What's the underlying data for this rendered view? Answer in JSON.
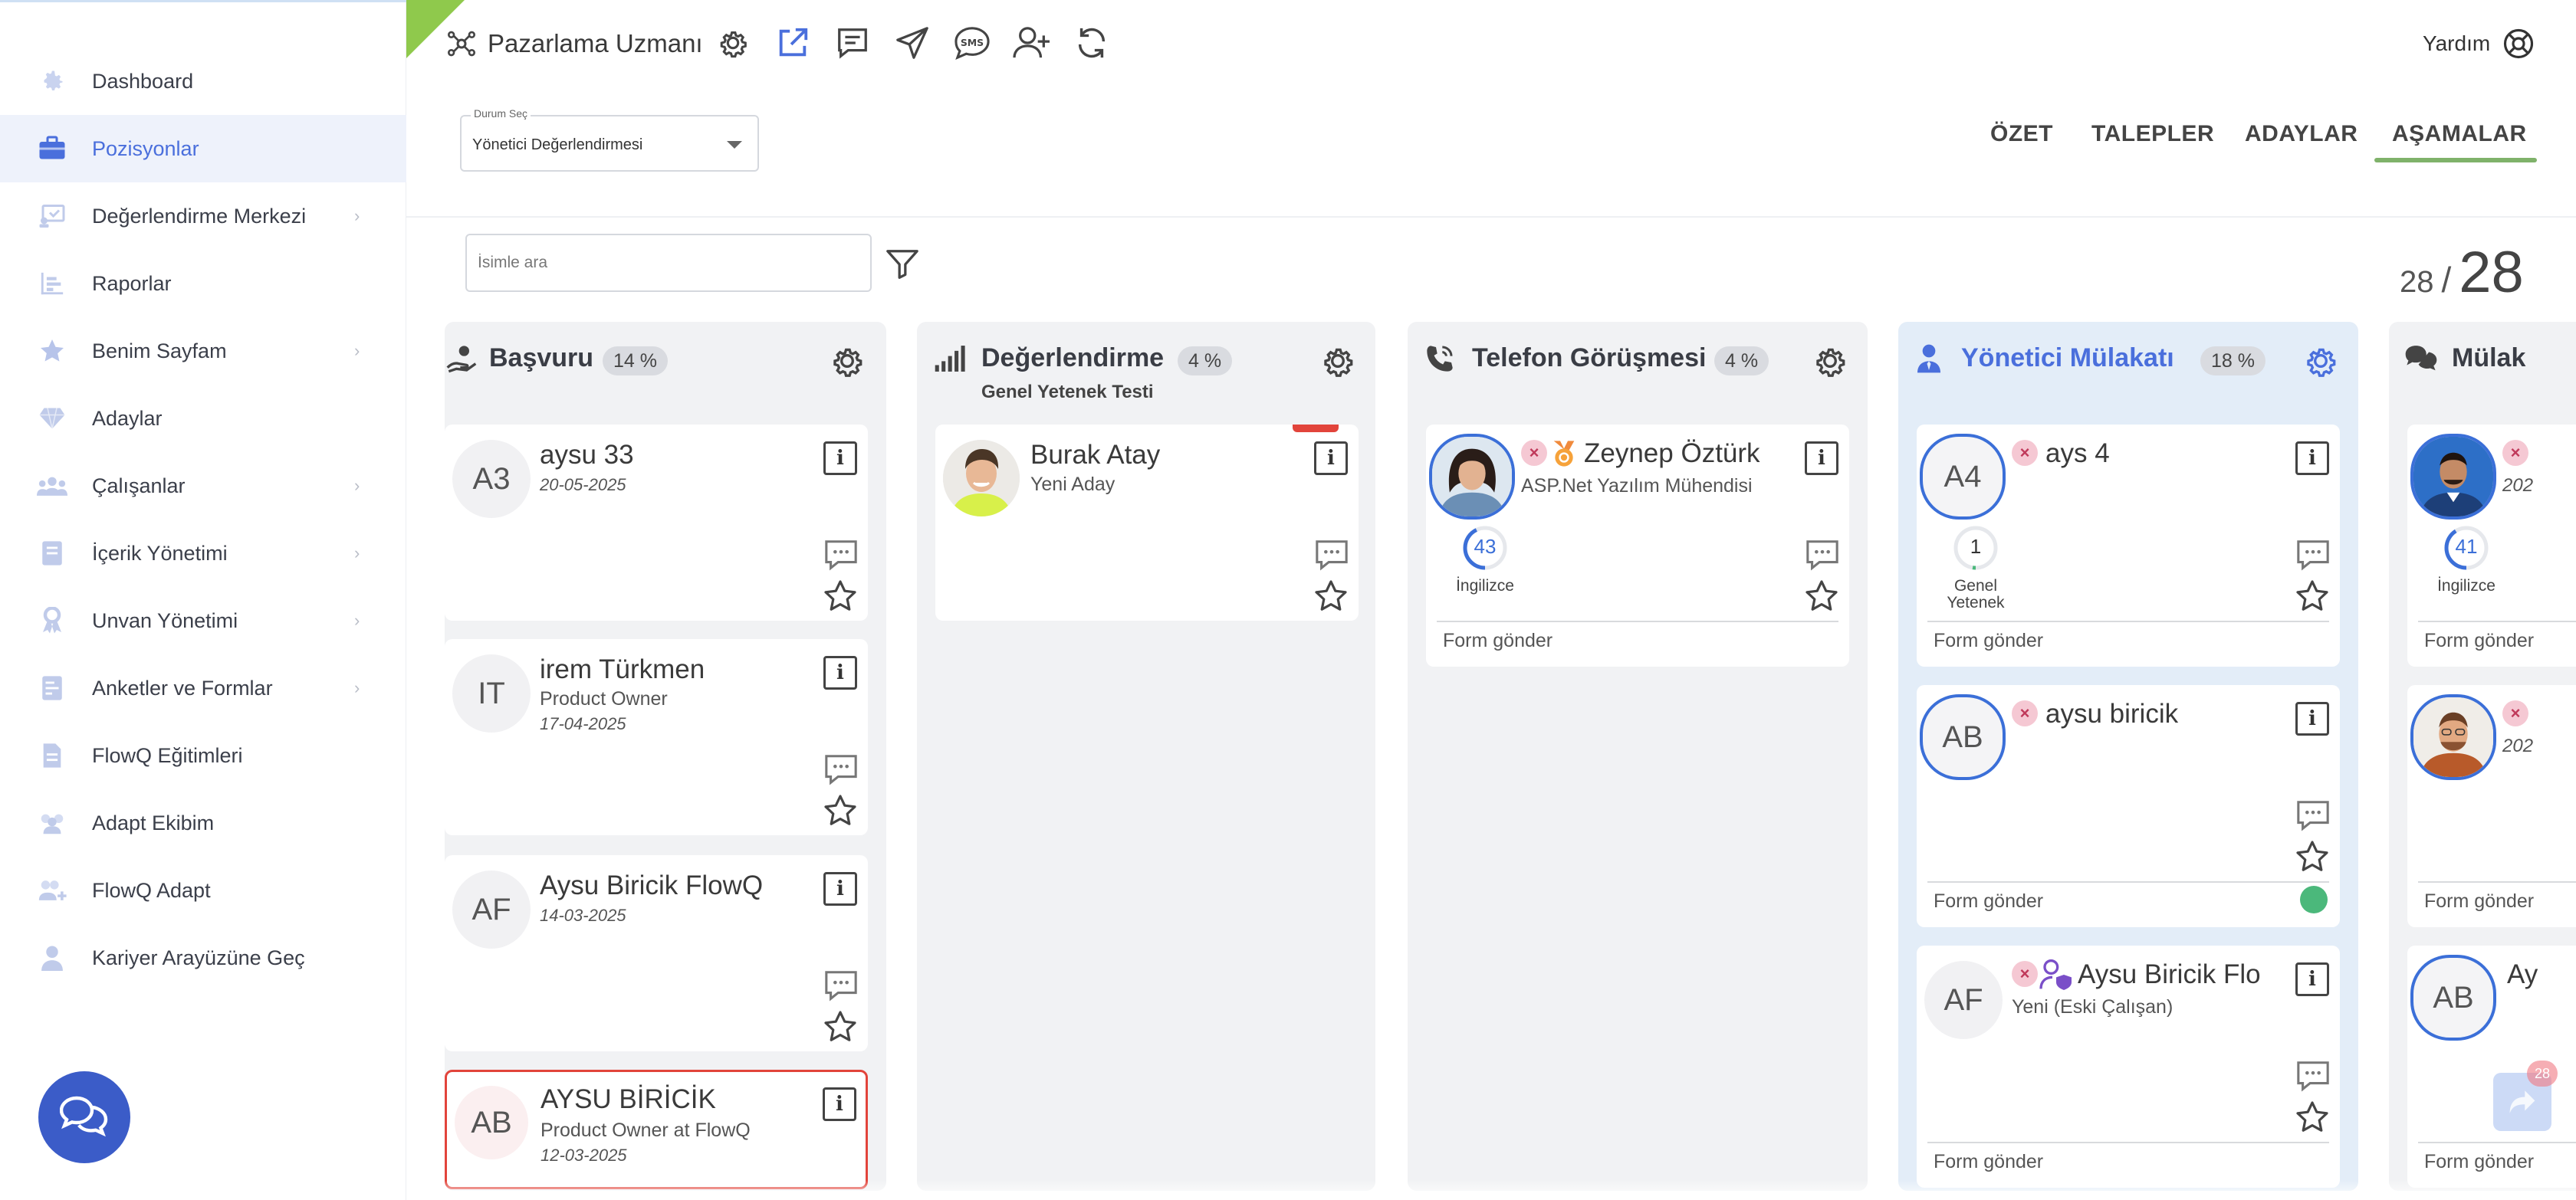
{
  "sidebar": {
    "items": [
      {
        "label": "Dashboard",
        "icon": "gear-icon"
      },
      {
        "label": "Pozisyonlar",
        "icon": "briefcase-icon"
      },
      {
        "label": "Değerlendirme Merkezi",
        "icon": "assessment-icon"
      },
      {
        "label": "Raporlar",
        "icon": "report-icon"
      },
      {
        "label": "Benim Sayfam",
        "icon": "star-icon"
      },
      {
        "label": "Adaylar",
        "icon": "diamond-icon"
      },
      {
        "label": "Çalışanlar",
        "icon": "people-icon"
      },
      {
        "label": "İçerik Yönetimi",
        "icon": "book-icon"
      },
      {
        "label": "Unvan Yönetimi",
        "icon": "ribbon-icon"
      },
      {
        "label": "Anketler ve Formlar",
        "icon": "form-icon"
      },
      {
        "label": "FlowQ Eğitimleri",
        "icon": "document-icon"
      },
      {
        "label": "Adapt Ekibim",
        "icon": "team-icon"
      },
      {
        "label": "FlowQ Adapt",
        "icon": "add-team-icon"
      },
      {
        "label": "Kariyer Arayüzüne Geç",
        "icon": "user-icon"
      }
    ]
  },
  "header": {
    "title": "Pazarlama Uzmanı",
    "help_label": "Yardım",
    "status_select": {
      "label": "Durum Seç",
      "value": "Yönetici Değerlendirmesi"
    },
    "tabs": [
      "ÖZET",
      "TALEPLER",
      "ADAYLAR",
      "AŞAMALAR"
    ],
    "search_placeholder": "İsimle ara",
    "count_shown": "28",
    "count_sep": "/",
    "count_total": "28"
  },
  "columns": [
    {
      "title": "Başvuru",
      "pct": "14 %",
      "cards": [
        {
          "initials": "A3",
          "name": "aysu 33",
          "date": "20-05-2025"
        },
        {
          "initials": "IT",
          "name": "irem Türkmen",
          "sub": "Product Owner",
          "date": "17-04-2025"
        },
        {
          "initials": "AF",
          "name": "Aysu Biricik FlowQ",
          "date": "14-03-2025"
        },
        {
          "initials": "AB",
          "name": "AYSU BİRİCİK",
          "sub": "Product Owner at FlowQ",
          "date": "12-03-2025"
        }
      ]
    },
    {
      "title": "Değerlendirme",
      "pct": "4 %",
      "subtitle": "Genel Yetenek Testi",
      "cards": [
        {
          "name": "Burak Atay",
          "sub": "Yeni Aday"
        }
      ]
    },
    {
      "title": "Telefon Görüşmesi",
      "pct": "4 %",
      "cards": [
        {
          "name": "Zeynep Öztürk",
          "sub": "ASP.Net Yazılım Mühendisi",
          "skill_value": "43",
          "skill_label": "İngilizce",
          "form": "Form gönder"
        }
      ]
    },
    {
      "title": "Yönetici Mülakatı",
      "pct": "18 %",
      "cards": [
        {
          "initials": "A4",
          "name": "ays 4",
          "skill_value": "1",
          "skill_label": "Genel Yetenek",
          "form": "Form gönder"
        },
        {
          "initials": "AB",
          "name": "aysu biricik",
          "form": "Form gönder"
        },
        {
          "initials": "AF",
          "name": "Aysu Biricik Flo",
          "sub": "Yeni (Eski Çalışan)",
          "form": "Form gönder"
        }
      ]
    },
    {
      "title": "Mülak",
      "cards": [
        {
          "date": "202",
          "skill_value": "41",
          "skill_label": "İngilizce",
          "form": "Form gönder"
        },
        {
          "date": "202",
          "form": "Form gönder"
        },
        {
          "initials": "AB",
          "name": "Ay",
          "form": "Form gönder"
        }
      ]
    }
  ],
  "fab_badge": "28",
  "colors": {
    "accent": "#4a6fdc",
    "brand_green": "#8fc94c",
    "tab_underline": "#7fb26a",
    "avatar_ring": "#3b6fd8",
    "danger": "#e2443b",
    "success": "#4bb87b",
    "chat_button": "#3b5cc8"
  }
}
